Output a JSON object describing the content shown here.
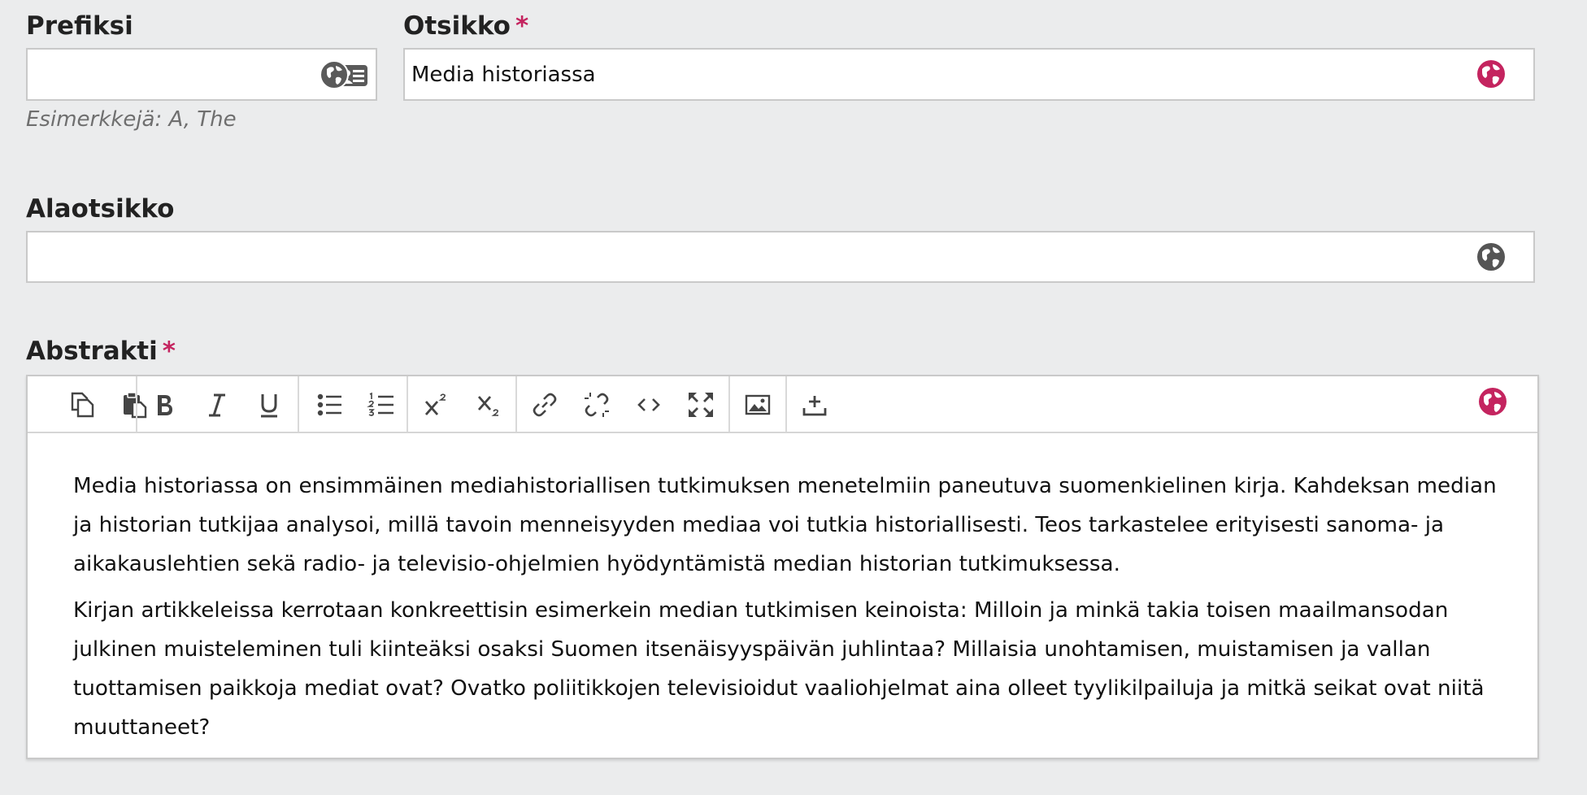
{
  "prefix": {
    "label": "Prefiksi",
    "value": "",
    "hint": "Esimerkkejä: A, The"
  },
  "title": {
    "label": "Otsikko",
    "required_mark": "*",
    "value": "Media historiassa"
  },
  "subtitle": {
    "label": "Alaotsikko",
    "value": ""
  },
  "abstract": {
    "label": "Abstrakti",
    "required_mark": "*",
    "toolbar": [
      "copy-icon",
      "paste-icon",
      "bold-icon",
      "italic-icon",
      "underline-icon",
      "bullet-list-icon",
      "numbered-list-icon",
      "superscript-icon",
      "subscript-icon",
      "link-icon",
      "unlink-icon",
      "code-icon",
      "fullscreen-icon",
      "image-icon",
      "upload-icon",
      "globe-icon"
    ],
    "paragraphs": [
      "Media historiassa on ensimmäinen mediahistoriallisen tutkimuksen menetelmiin paneutuva suomenkielinen kirja. Kahdeksan median ja historian tutkijaa analysoi, millä tavoin menneisyyden mediaa voi tutkia historiallisesti. Teos tarkastelee erityisesti sanoma- ja aikakauslehtien sekä radio- ja televisio-ohjelmien hyödyntämistä median historian tutkimuksessa.",
      "Kirjan artikkeleissa kerrotaan konkreettisin esimerkein median tutkimisen keinoista: Milloin ja minkä takia toisen maailmansodan julkinen muisteleminen tuli kiinteäksi osaksi Suomen itsenäisyyspäivän juhlintaa? Millaisia unohtamisen, muistamisen ja vallan tuottamisen paikkoja mediat ovat? Ovatko poliitikkojen televisioidut vaaliohjelmat aina olleet tyylikilpailuja ja mitkä seikat ovat niitä muuttaneet?"
    ]
  },
  "colors": {
    "accent": "#c4245f",
    "globe_inactive": "#555555",
    "background": "#ebeced"
  }
}
